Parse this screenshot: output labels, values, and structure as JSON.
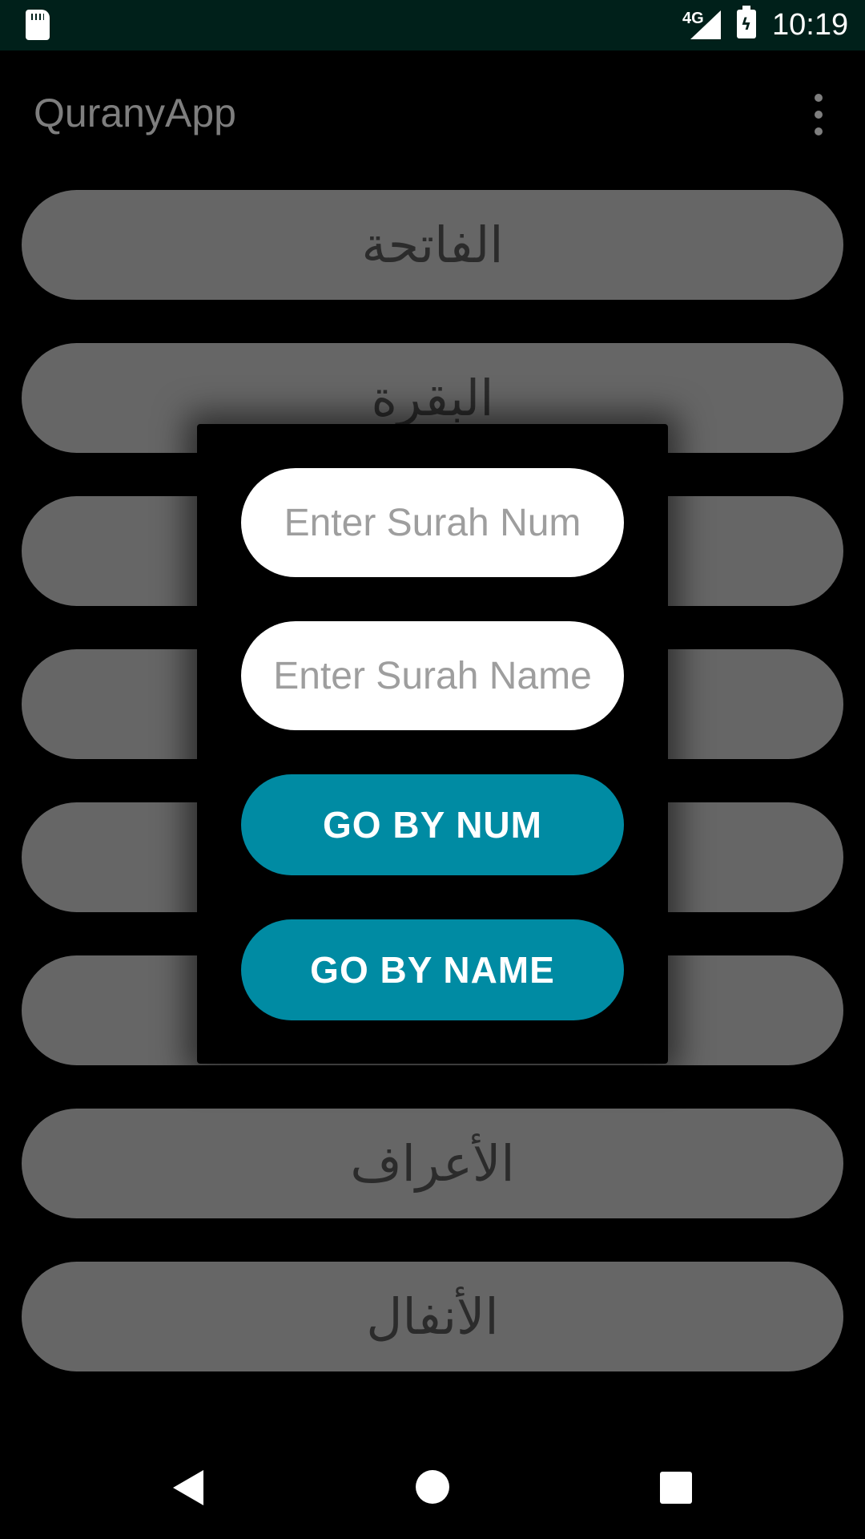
{
  "status_bar": {
    "network": "4G",
    "time": "10:19",
    "icons": [
      "sd-card-icon",
      "signal-icon",
      "battery-charging-icon"
    ]
  },
  "app_bar": {
    "title": "QuranyApp",
    "menu_icon": "more-vert-icon"
  },
  "surah_list": {
    "items": [
      {
        "name": "الفاتحة"
      },
      {
        "name": "البقرة"
      },
      {
        "name": ""
      },
      {
        "name": ""
      },
      {
        "name": ""
      },
      {
        "name": ""
      },
      {
        "name": "الأعراف"
      },
      {
        "name": "الأنفال"
      }
    ]
  },
  "dialog": {
    "num_field": {
      "placeholder": "Enter Surah Num",
      "value": ""
    },
    "name_field": {
      "placeholder": "Enter Surah Name",
      "value": ""
    },
    "go_by_num_label": "GO BY NUM",
    "go_by_name_label": "GO BY NAME"
  },
  "nav_bar": {
    "icons": [
      "back-icon",
      "home-icon",
      "recents-icon"
    ]
  },
  "colors": {
    "status_bar": "#00201a",
    "pill": "#666666",
    "button": "#008ba3",
    "field": "#ffffff"
  }
}
